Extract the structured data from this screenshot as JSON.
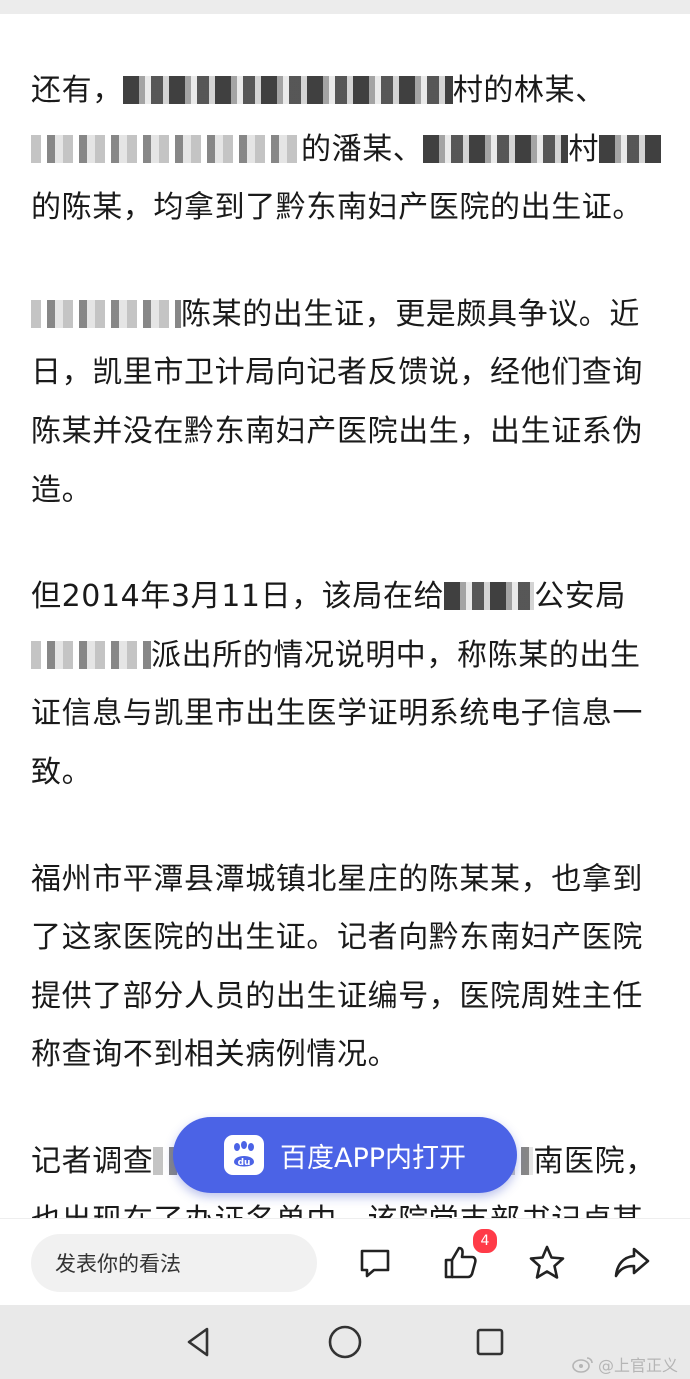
{
  "article": {
    "p1": {
      "a": "还有，",
      "b": "村的林某、",
      "c": "的潘某、",
      "d": "村",
      "e": "的陈某，均拿到了黔东南妇产医院的出生证。"
    },
    "p2": {
      "a": "陈某的出生证，更是颇具争议。近日，凯里市卫计局向记者反馈说，经他们查询陈某并没在黔东南妇产医院出生，出生证系伪造。"
    },
    "p3": {
      "a": "但2014年3月11日，该局在给",
      "b": "公安局",
      "c": "派出所的情况说明中，称陈某的出生证信息与凯里市出生医学证明系统电子信息一致。"
    },
    "p4": {
      "a": "福州市平潭县潭城镇北星庄的陈某某，也拿到了这家医院的出生证。记者向黔东南妇产医院提供了部分人员的出生证编号，医院周姓主任称查询不到相关病例情况。"
    },
    "p5": {
      "a": "记者调查",
      "b": "南医院，也出现在了办证名单中。该院党支部书记卓某"
    }
  },
  "floating": {
    "label": "百度APP内打开",
    "icon": "baidu-du-icon"
  },
  "bottom": {
    "comment_placeholder": "发表你的看法",
    "like_count": "4",
    "icons": [
      "comment-icon",
      "thumbs-up-icon",
      "star-icon",
      "share-icon"
    ]
  },
  "nav": {
    "icons": [
      "back-triangle-icon",
      "home-circle-icon",
      "recents-square-icon"
    ]
  },
  "watermark": {
    "text": "@上官正义"
  },
  "colors": {
    "accent": "#4b63e6",
    "badge": "#ff3b48"
  }
}
